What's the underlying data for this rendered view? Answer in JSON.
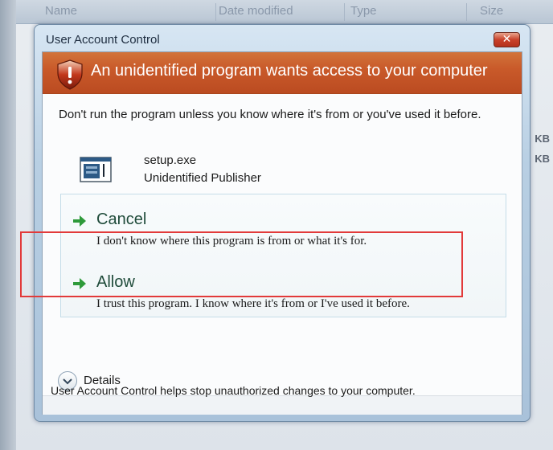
{
  "background": {
    "columns": [
      "Name",
      "Date modified",
      "Type",
      "Size"
    ],
    "size_units": [
      "KB",
      "KB"
    ]
  },
  "dialog": {
    "title": "User Account Control",
    "close_glyph": "✕",
    "banner": "An unidentified program wants access to your computer",
    "intro": "Don't run the program unless you know where it's from or you've used it before.",
    "program": {
      "name": "setup.exe",
      "publisher": "Unidentified Publisher",
      "icon": "program-window-icon"
    },
    "options": [
      {
        "title": "Cancel",
        "description": "I don't know where this program is from or what it's for.",
        "icon": "green-arrow-icon"
      },
      {
        "title": "Allow",
        "description": "I trust this program. I know where it's from or I've used it before.",
        "icon": "green-arrow-icon"
      }
    ],
    "details_label": "Details",
    "footer": "User Account Control helps stop unauthorized changes to your computer."
  },
  "colors": {
    "banner": "#c95a2a",
    "highlight": "#e23a3a",
    "arrow": "#2e9a3a"
  }
}
